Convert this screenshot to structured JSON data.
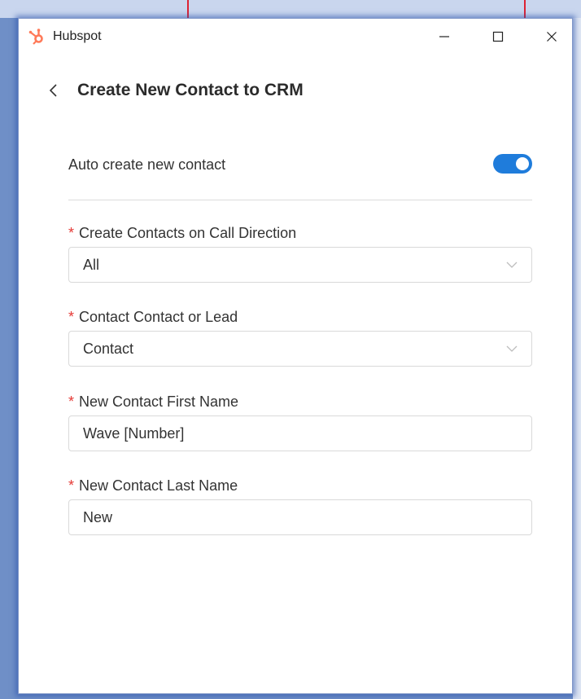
{
  "window": {
    "title": "Hubspot",
    "logo_icon": "hubspot-sprocket-icon",
    "accent_logo": "#ff7a59"
  },
  "header": {
    "back_icon": "chevron-left-icon",
    "title": "Create New Contact to CRM"
  },
  "auto_create": {
    "label": "Auto create new contact",
    "enabled": true,
    "toggle_color": "#1f7cdb"
  },
  "fields": {
    "call_direction": {
      "required_mark": "*",
      "label": "Create Contacts on Call Direction",
      "value": "All",
      "type": "select"
    },
    "contact_type": {
      "required_mark": "*",
      "label": "Contact Contact or Lead",
      "value": "Contact",
      "type": "select"
    },
    "first_name": {
      "required_mark": "*",
      "label": "New Contact First Name",
      "value": "Wave [Number]",
      "type": "text"
    },
    "last_name": {
      "required_mark": "*",
      "label": "New Contact Last Name",
      "value": "New",
      "type": "text"
    }
  }
}
